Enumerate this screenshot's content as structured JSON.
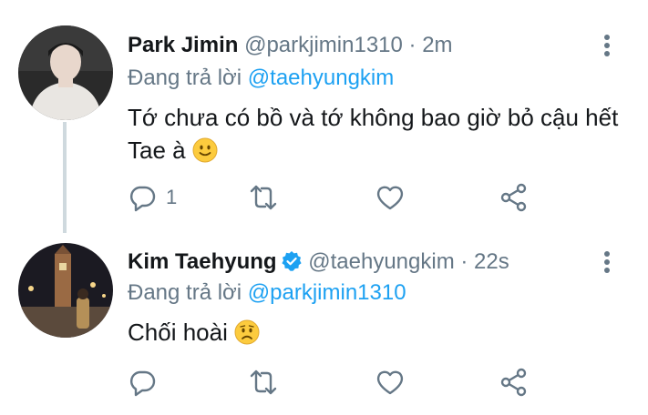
{
  "tweets": [
    {
      "name": "Park Jimin",
      "handle": "@parkjimin1310",
      "time": "· 2m",
      "replying_prefix": "Đang trả lời",
      "replying_to": "@taehyungkim",
      "text": "Tớ chưa có bồ và tớ không bao giờ bỏ cậu hết Tae à",
      "emoji": "slightly-smiling-face",
      "reply_count": "1",
      "verified": false
    },
    {
      "name": "Kim Taehyung",
      "handle": "@taehyungkim",
      "time": "· 22s",
      "replying_prefix": "Đang trả lời",
      "replying_to": "@parkjimin1310",
      "text": "Chối hoài",
      "emoji": "worried-face",
      "reply_count": "",
      "verified": true
    }
  ],
  "colors": {
    "link": "#1da1f2",
    "secondary": "#657786",
    "verified": "#1da1f2",
    "thread_line": "#cfd9de"
  }
}
